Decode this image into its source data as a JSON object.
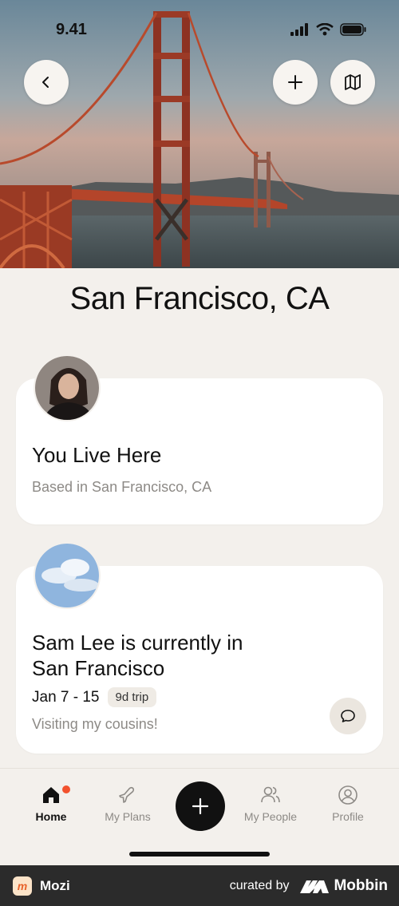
{
  "status": {
    "time": "9.41"
  },
  "hero": {
    "back_icon": "chevron-left-icon",
    "add_icon": "plus-icon",
    "map_icon": "map-icon"
  },
  "city": {
    "title": "San Francisco, CA"
  },
  "cards": [
    {
      "title": "You Live Here",
      "subtitle": "Based in San Francisco, CA"
    },
    {
      "title_line1": "Sam Lee is currently in",
      "title_line2": "San Francisco",
      "dates": "Jan 7 - 15",
      "badge": "9d trip",
      "note": "Visiting my cousins!"
    }
  ],
  "nav": {
    "items": [
      {
        "label": "Home",
        "icon": "home-icon",
        "active": true
      },
      {
        "label": "My Plans",
        "icon": "plane-icon"
      },
      {
        "label": "My People",
        "icon": "people-icon"
      },
      {
        "label": "Profile",
        "icon": "profile-icon"
      }
    ],
    "accent": "#f2522e"
  },
  "footer": {
    "app_name": "Mozi",
    "curated_by": "curated by",
    "brand": "Mobbin"
  }
}
